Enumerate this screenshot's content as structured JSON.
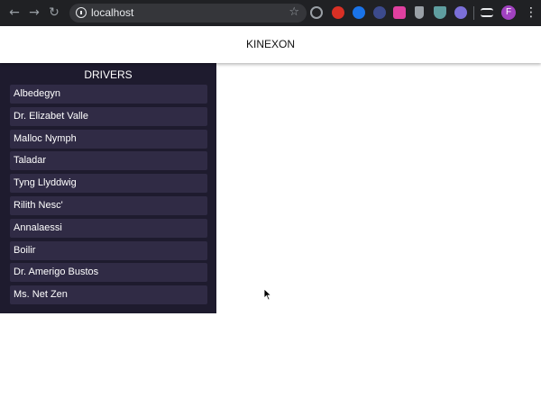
{
  "browser": {
    "url": "localhost",
    "profile_initial": "F",
    "icons": {
      "back": "arrow-left-icon",
      "forward": "arrow-right-icon",
      "reload": "reload-icon",
      "info": "info-icon",
      "bookmark": "star-icon",
      "menu": "kebab-menu-icon"
    },
    "extension_colors": [
      "#9aa0a6",
      "#d93025",
      "#1a73e8",
      "#3c4a8c",
      "#e040a0",
      "#9aa0a6",
      "#5f9ea0",
      "#7b6fd8",
      "#e8eaed"
    ]
  },
  "app": {
    "title": "KINEXON"
  },
  "sidebar": {
    "title": "DRIVERS",
    "drivers": [
      {
        "name": "Albedegyn"
      },
      {
        "name": "Dr. Elizabet Valle"
      },
      {
        "name": "Malloc Nymph"
      },
      {
        "name": "Taladar"
      },
      {
        "name": "Tyng Llyddwig"
      },
      {
        "name": "Rilith Nesc'"
      },
      {
        "name": "Annalaessi"
      },
      {
        "name": "Boilir"
      },
      {
        "name": "Dr. Amerigo Bustos"
      },
      {
        "name": "Ms. Net Zen"
      }
    ]
  },
  "colors": {
    "sidebar_bg": "#1e1b2e",
    "driver_item_bg": "#302b45",
    "chrome_bg": "#202124"
  }
}
